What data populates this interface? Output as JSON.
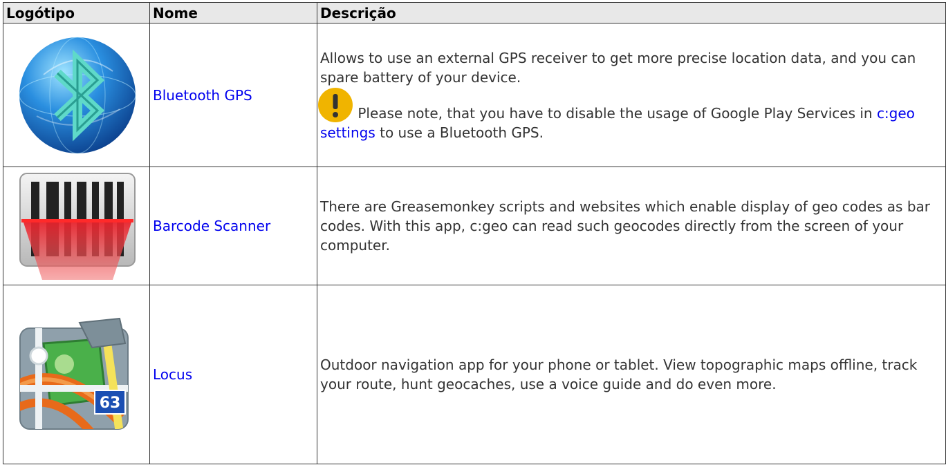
{
  "table": {
    "headers": [
      "Logótipo",
      "Nome",
      "Descrição"
    ],
    "rows": [
      {
        "logo_icon": "bluetooth-globe-icon",
        "name": "Bluetooth GPS",
        "description": "Allows to use an external GPS receiver to get more precise location data, and you can spare battery of your device.",
        "note_icon": "warning-exclamation-icon",
        "note_before": "Please note, that you have to disable the usage of Google Play Services in ",
        "note_link": "c:geo settings",
        "note_after": " to use a Bluetooth GPS."
      },
      {
        "logo_icon": "barcode-scanner-icon",
        "name": "Barcode Scanner",
        "description": "There are Greasemonkey scripts and websites which enable display of geo codes as bar codes. With this app, c:geo can read such geocodes directly from the screen of your computer."
      },
      {
        "logo_icon": "locus-map-icon",
        "logo_badge": "63",
        "name": "Locus",
        "description": "Outdoor navigation app for your phone or tablet. View topographic maps offline, track your route, hunt geocaches, use a voice guide and do even more."
      }
    ]
  },
  "colors": {
    "link": "#0000ee",
    "border": "#333333",
    "header_bg": "#e8e8e8",
    "warning": "#f0b400"
  }
}
